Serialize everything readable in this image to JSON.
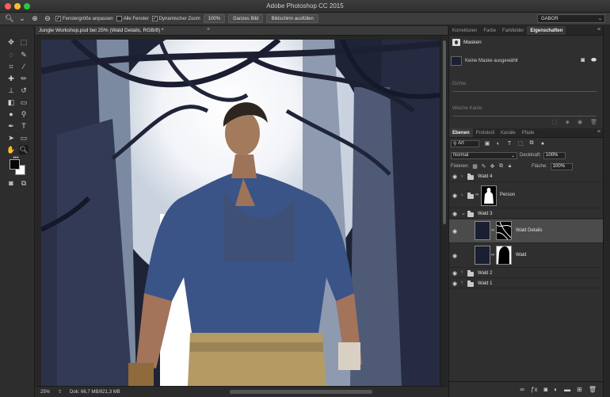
{
  "app": {
    "title": "Adobe Photoshop CC 2015"
  },
  "options_bar": {
    "checkbox_resize": "Fenstergröße anpassen",
    "checkbox_all_windows": "Alle Fenster",
    "checkbox_scrubby": "Dynamischer Zoom",
    "zoom_value": "100%",
    "btn_fit": "Ganzes Bild",
    "btn_fill": "Bildschirm ausfüllen",
    "workspace": "GABOR"
  },
  "document": {
    "tab_label": "Jungle Workshop.psd bei 25% (Wald Details, RGB/8) *",
    "zoom": "25%",
    "doc_info": "Dok: 66,7 MB/821,3 MB"
  },
  "colors": {
    "foreground": "#050505",
    "background": "#ffffff",
    "canvas_dark": "#1d2233",
    "accent": "#4b4b4b"
  },
  "properties_panel": {
    "tabs": [
      "Korrekturen",
      "Farbe",
      "Farbfelder",
      "Eigenschaften"
    ],
    "active_tab": "Eigenschaften",
    "section": "Masken",
    "mask_status": "Keine Maske ausgewählt",
    "density_label": "Dichte:",
    "feather_label": "Weiche Kante:"
  },
  "layers_panel": {
    "tabs": [
      "Ebenen",
      "Protokoll",
      "Kanäle",
      "Pfade"
    ],
    "active_tab": "Ebenen",
    "kind_filter": "Art",
    "blend_mode": "Normal",
    "opacity_label": "Deckkraft:",
    "opacity_value": "100%",
    "lock_label": "Fixieren:",
    "fill_label": "Fläche:",
    "fill_value": "100%",
    "layers": [
      {
        "name": "Wald 4",
        "type": "group"
      },
      {
        "name": "Person",
        "type": "group-with-mask"
      },
      {
        "name": "Wald 3",
        "type": "group-open"
      },
      {
        "name": "Wald Details",
        "type": "layer",
        "selected": true
      },
      {
        "name": "Wald",
        "type": "layer"
      },
      {
        "name": "Wald 2",
        "type": "group"
      },
      {
        "name": "Wald 1",
        "type": "group"
      }
    ]
  }
}
